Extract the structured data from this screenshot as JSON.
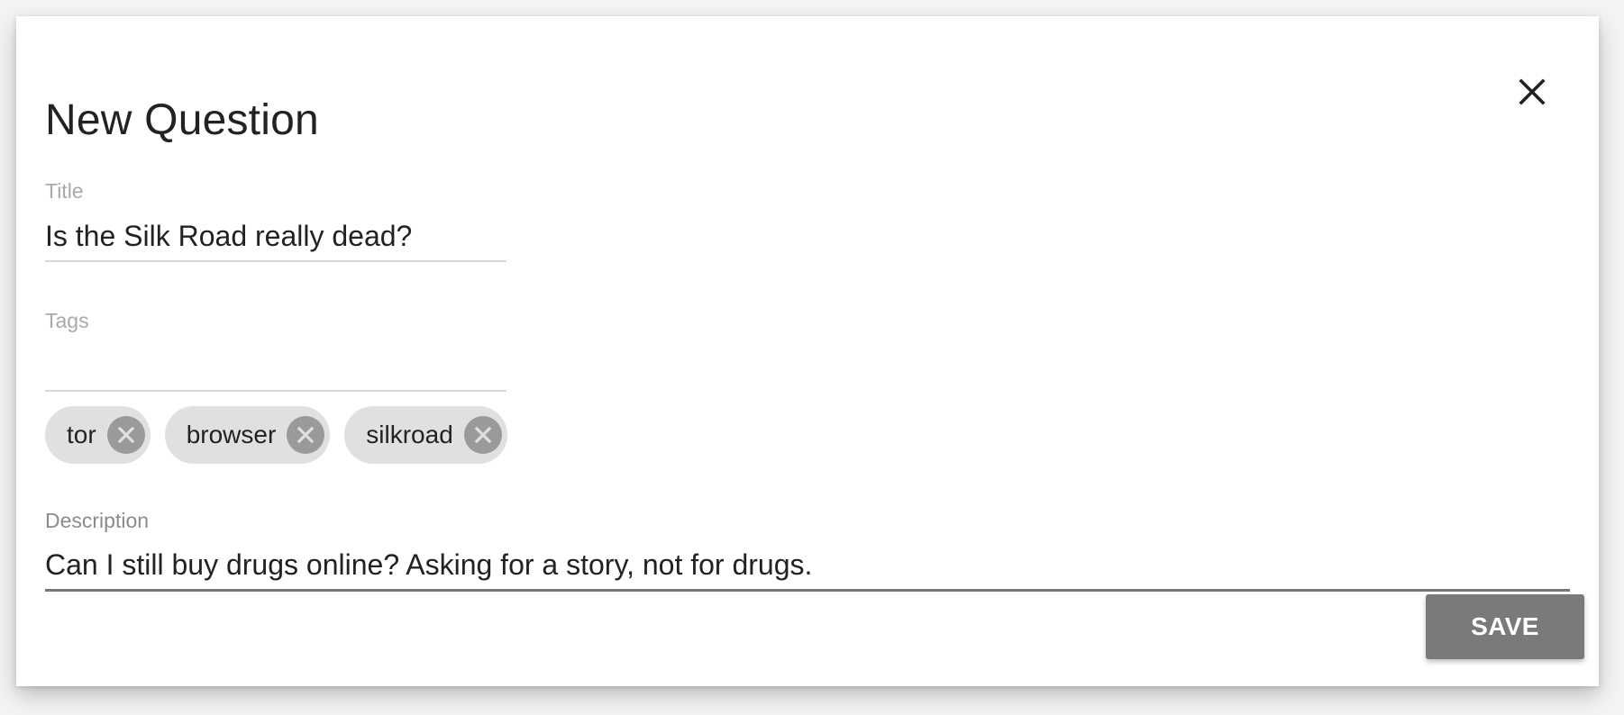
{
  "dialog": {
    "title": "New Question",
    "close_icon": "close-icon"
  },
  "fields": {
    "title": {
      "label": "Title",
      "value": "Is the Silk Road really dead?"
    },
    "tags": {
      "label": "Tags",
      "input_value": "",
      "chips": [
        {
          "label": "tor",
          "remove_icon": "close-circle-icon"
        },
        {
          "label": "browser",
          "remove_icon": "close-circle-icon"
        },
        {
          "label": "silkroad",
          "remove_icon": "close-circle-icon"
        }
      ]
    },
    "description": {
      "label": "Description",
      "value": "Can I still buy drugs online? Asking for a story, not for drugs."
    }
  },
  "actions": {
    "save_label": "SAVE"
  },
  "colors": {
    "backdrop": "#f4f4f4",
    "surface": "#ffffff",
    "text": "#222222",
    "label": "#a9a9a9",
    "active_label": "#8b8b8b",
    "chip_background": "#e0e0e0",
    "chip_remove": "#9a9a9a",
    "button": "#7a7a7a"
  }
}
